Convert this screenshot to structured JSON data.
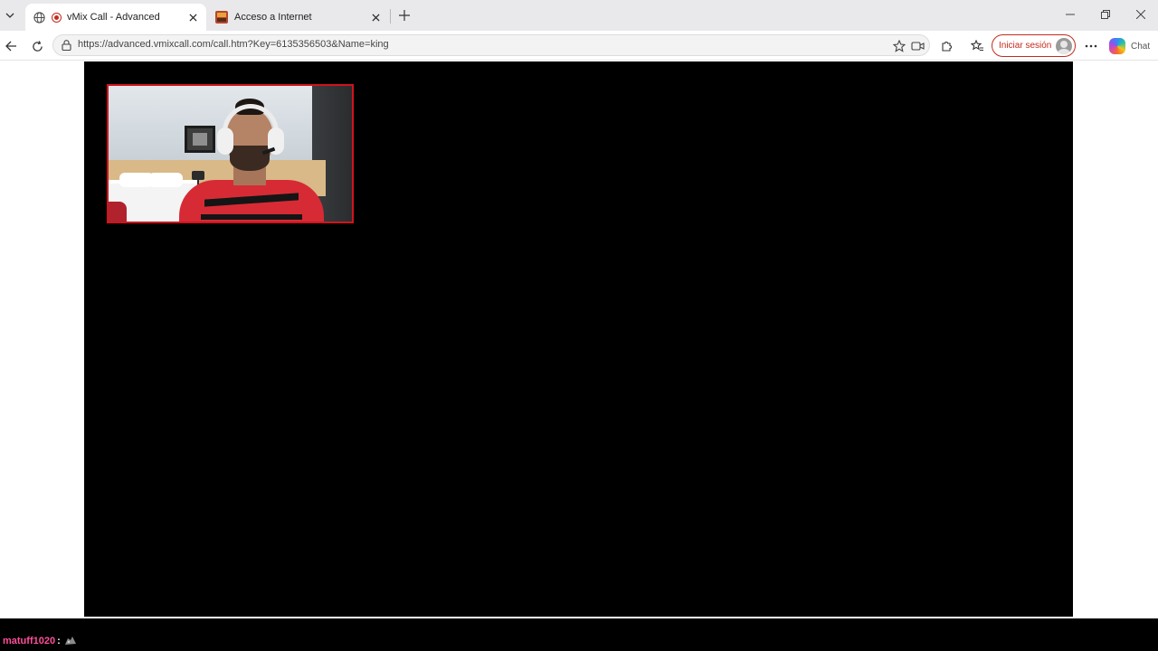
{
  "browser": {
    "tabs": [
      {
        "title": "vMix Call - Advanced",
        "active": true,
        "favicon": "globe-icon",
        "status_icon": "recording-icon"
      },
      {
        "title": "Acceso a Internet",
        "active": false,
        "favicon": "portal-favicon"
      }
    ],
    "new_tab_icon": "plus-icon",
    "url": "https://advanced.vmixcall.com/call.htm?Key=6135356503&Name=king",
    "signin_label": "Iniciar sesión",
    "copilot_label": "Chat",
    "accent_color": "#c42b1c"
  },
  "call": {
    "preview_border_color": "#d1131d",
    "stage_color": "#000000"
  },
  "overlay": {
    "chat_user": "matuff1020",
    "chat_separator": ":",
    "chat_user_color": "#ff4f9a",
    "emote_icon": "emote-icon"
  }
}
